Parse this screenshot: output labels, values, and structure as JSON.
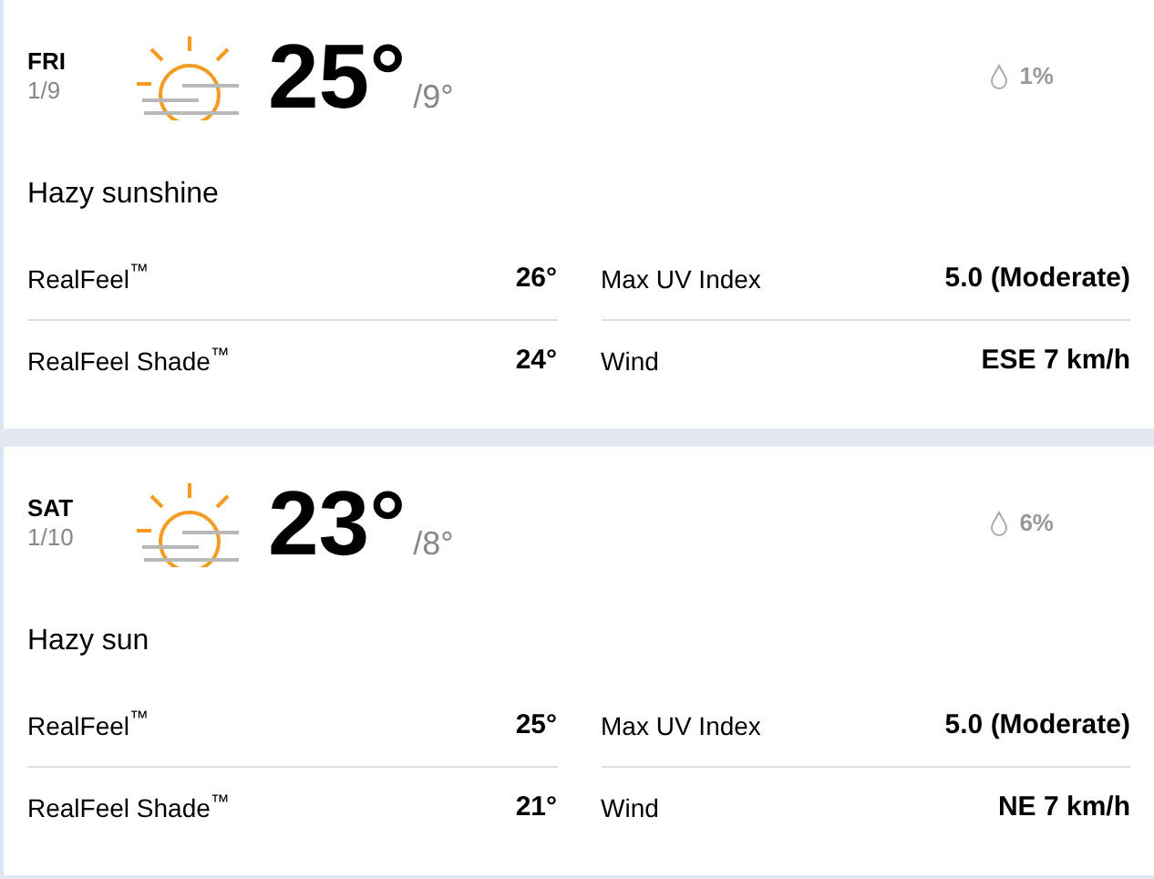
{
  "days": [
    {
      "day": "FRI",
      "date": "1/9",
      "temp": "25°",
      "low": "/9°",
      "precip": "1%",
      "phrase": "Hazy sunshine",
      "details": [
        {
          "label": "RealFeel$^{™}$",
          "value": "26°"
        },
        {
          "label": "Max UV Index",
          "value": "5.0 (Moderate)"
        },
        {
          "label": "RealFeel Shade$^{™}$",
          "value": "24°"
        },
        {
          "label": "Wind",
          "value": "ESE 7 km/h"
        }
      ]
    },
    {
      "day": "SAT",
      "date": "1/10",
      "temp": "23°",
      "low": "/8°",
      "precip": "6%",
      "phrase": "Hazy sun",
      "details": [
        {
          "label": "RealFeel$^{™}$",
          "value": "25°"
        },
        {
          "label": "Max UV Index",
          "value": "5.0 (Moderate)"
        },
        {
          "label": "RealFeel Shade$^{™}$",
          "value": "21°"
        },
        {
          "label": "Wind",
          "value": "NE 7 km/h"
        }
      ]
    }
  ]
}
